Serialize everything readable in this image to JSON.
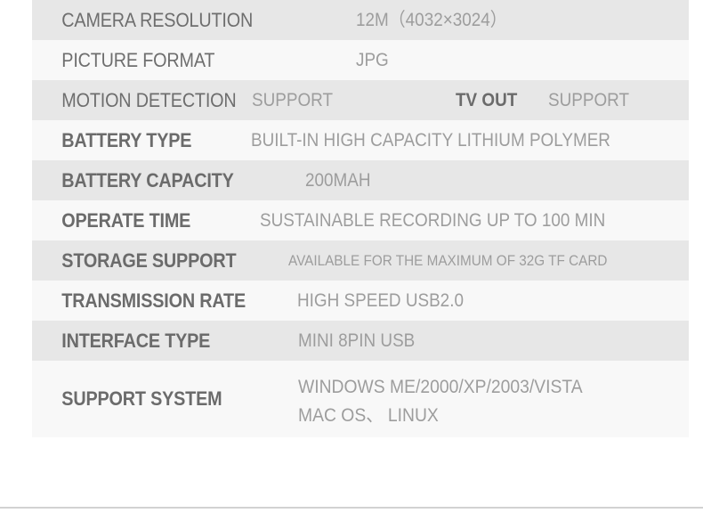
{
  "spec_table": {
    "colors": {
      "band_dark": "#e7e7e7",
      "band_light": "#f8f8f8",
      "label_text": "#6e6e6e",
      "value_text": "#9d9d9d",
      "emphasis_text": "#6b6b6b",
      "page_background": "#ffffff",
      "divider": "#d2d2d2"
    },
    "rows": [
      {
        "label": "CAMERA RESOLUTION",
        "value": "12M（4032×3024）"
      },
      {
        "label": "PICTURE FORMAT",
        "value": "JPG"
      },
      {
        "label": "MOTION DETECTION",
        "value": "SUPPORT",
        "label2": "TV OUT",
        "value2": "SUPPORT"
      },
      {
        "label": "BATTERY TYPE",
        "value": "BUILT-IN HIGH CAPACITY LITHIUM POLYMER"
      },
      {
        "label": "BATTERY CAPACITY",
        "value": "200MAH"
      },
      {
        "label": "OPERATE TIME",
        "value": "SUSTAINABLE RECORDING UP TO 100 MIN"
      },
      {
        "label": "STORAGE SUPPORT",
        "value": "AVAILABLE FOR THE MAXIMUM OF 32G TF CARD"
      },
      {
        "label": "TRANSMISSION RATE",
        "value": "HIGH SPEED USB2.0"
      },
      {
        "label": "INTERFACE TYPE",
        "value": "MINI 8PIN USB"
      },
      {
        "label": "SUPPORT SYSTEM",
        "value_line1": "WINDOWS ME/2000/XP/2003/VISTA",
        "value_line2": "MAC OS、 LINUX"
      }
    ]
  }
}
